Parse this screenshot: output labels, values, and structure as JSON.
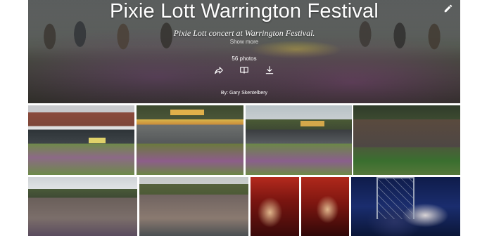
{
  "album": {
    "title": "Pixie Lott Warrington Festival",
    "description": "Pixie Lott concert at Warrington Festival.",
    "show_more": "Show more",
    "photo_count": "56 photos",
    "byline": "By: Gary Skentelbery"
  },
  "icons": {
    "edit": "pencil-icon",
    "share": "share-arrow-icon",
    "slideshow": "open-book-icon",
    "download": "download-icon"
  },
  "colors": {
    "hero_text": "#ffffff",
    "page_background": "#ffffff"
  }
}
